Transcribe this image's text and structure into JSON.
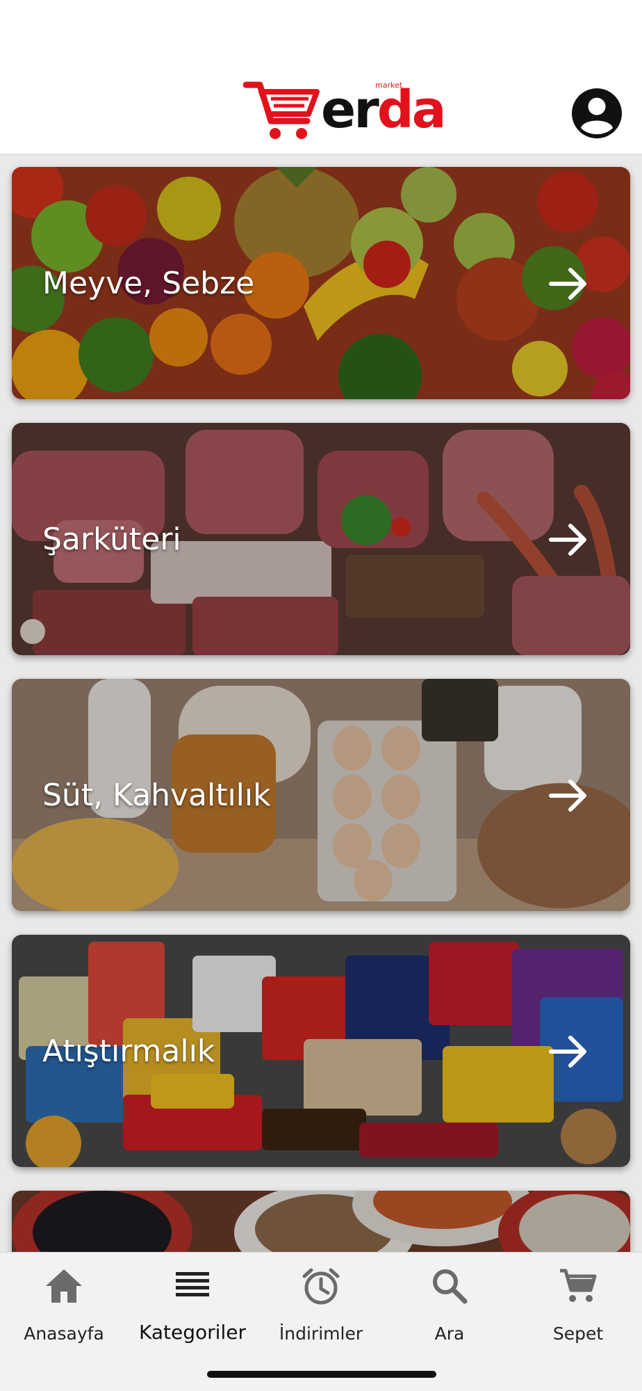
{
  "header": {
    "logo_er": "er",
    "logo_da": "da",
    "logo_small": "market",
    "brand_color": "#e1121b",
    "profile_icon": "account-circle-icon"
  },
  "categories": [
    {
      "title": "Meyve, Sebze",
      "theme": "fruits-vegetables"
    },
    {
      "title": "Şarküteri",
      "theme": "meat"
    },
    {
      "title": "Süt, Kahvaltılık",
      "theme": "dairy-breakfast"
    },
    {
      "title": "Atıştırmalık",
      "theme": "snacks"
    },
    {
      "title": "",
      "theme": "legumes"
    }
  ],
  "tabbar": {
    "items": [
      {
        "label": "Anasayfa",
        "icon": "home-icon"
      },
      {
        "label": "Kategoriler",
        "icon": "list-icon"
      },
      {
        "label": "İndirimler",
        "icon": "alarm-clock-icon"
      },
      {
        "label": "Ara",
        "icon": "search-icon"
      },
      {
        "label": "Sepet",
        "icon": "cart-icon"
      }
    ],
    "active_index": 1,
    "icon_color": "#6b6b6b"
  }
}
